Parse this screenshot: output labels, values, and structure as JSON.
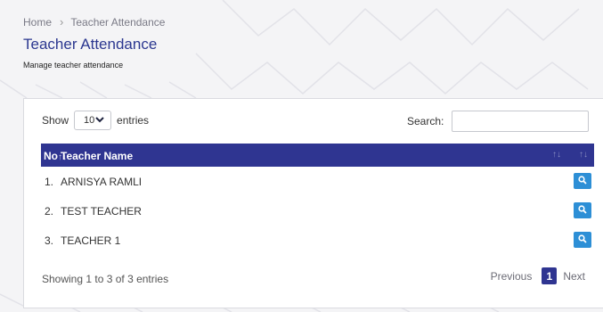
{
  "breadcrumb": {
    "home": "Home",
    "separator": "›",
    "current": "Teacher Attendance"
  },
  "page": {
    "title": "Teacher Attendance",
    "subtitle": "Manage teacher attendance"
  },
  "table_controls": {
    "show_label": "Show",
    "page_length": "10",
    "entries_label": "entries",
    "search_label": "Search:",
    "search_value": ""
  },
  "table": {
    "columns": [
      {
        "label": "No",
        "sort_indicator": "↑↓"
      },
      {
        "label": "Teacher Name",
        "sort_indicator": "↑↓"
      },
      {
        "label": "",
        "sort_indicator": "↑↓"
      }
    ],
    "rows": [
      {
        "no": "1.",
        "name": "ARNISYA RAMLI",
        "action_icon": "search-icon"
      },
      {
        "no": "2.",
        "name": "TEST TEACHER",
        "action_icon": "search-icon"
      },
      {
        "no": "3.",
        "name": "TEACHER 1",
        "action_icon": "search-icon"
      }
    ]
  },
  "pagination": {
    "info": "Showing 1 to 3 of 3 entries",
    "previous": "Previous",
    "current_page": "1",
    "next": "Next"
  },
  "colors": {
    "primary": "#2f3591",
    "title": "#2b3790",
    "action_button": "#2d8fd6",
    "background": "#f4f4f6"
  }
}
